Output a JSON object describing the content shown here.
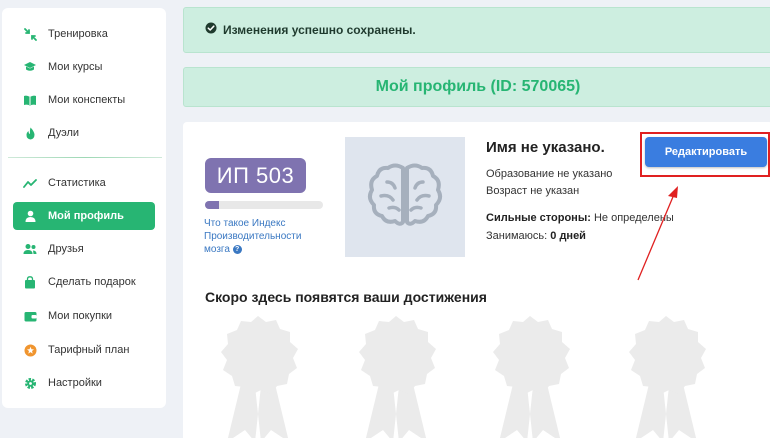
{
  "sidebar": {
    "items": [
      {
        "label": "Тренировка",
        "icon": "shrink-arrows-icon"
      },
      {
        "label": "Мои курсы",
        "icon": "graduation-cap-icon"
      },
      {
        "label": "Мои конспекты",
        "icon": "open-book-icon"
      },
      {
        "label": "Дуэли",
        "icon": "fire-icon"
      },
      {
        "label": "Статистика",
        "icon": "line-chart-icon"
      },
      {
        "label": "Мой профиль",
        "icon": "user-icon",
        "active": true
      },
      {
        "label": "Друзья",
        "icon": "users-icon"
      },
      {
        "label": "Сделать подарок",
        "icon": "shopping-bag-icon"
      },
      {
        "label": "Мои покупки",
        "icon": "wallet-icon"
      },
      {
        "label": "Тарифный план",
        "icon": "star-circle-icon"
      },
      {
        "label": "Настройки",
        "icon": "gear-icon"
      }
    ]
  },
  "alert": {
    "message": "Изменения успешно сохранены.",
    "icon": "check-circle-icon"
  },
  "profile": {
    "header_title": "Мой профиль (ID: 570065)",
    "ip_badge": "ИП 503",
    "ip_progress": 0.12,
    "ip_link": "Что такое Индекс Производительности мозга",
    "avatar_icon": "brain-icon",
    "name": "Имя не указано.",
    "education": "Образование не указано",
    "age": "Возраст не указан",
    "strengths_label": "Сильные стороны:",
    "strengths_value": "Не определены",
    "studying_label": "Занимаюсь:",
    "studying_value": "0 дней",
    "edit_button": "Редактировать"
  },
  "achievements": {
    "title": "Скоро здесь появятся ваши достижения",
    "placeholder_icon": "award-ribbon-icon"
  },
  "colors": {
    "accent_green": "#27b573",
    "alert_bg": "#cdeee0",
    "ip_purple": "#7f73b0",
    "button_blue": "#3a7de0",
    "highlight_red": "#e02020"
  }
}
